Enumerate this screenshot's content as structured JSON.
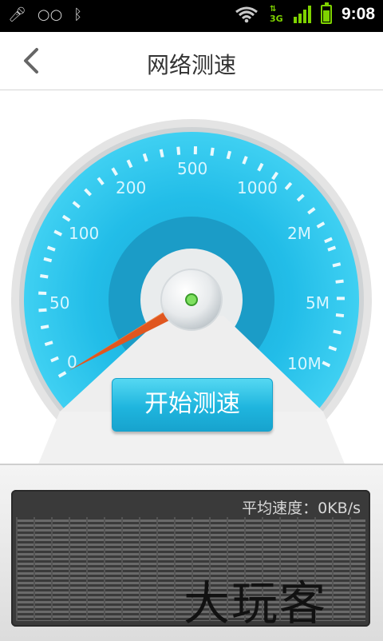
{
  "status_bar": {
    "time": "9:08",
    "network": "3G",
    "icons": [
      "mic-muted-icon",
      "voicemail-icon",
      "bluetooth-icon",
      "wifi-icon",
      "3g-signal-icon",
      "cell-signal-icon",
      "battery-icon"
    ]
  },
  "header": {
    "title": "网络测速",
    "back_icon": "back-arrow-icon"
  },
  "gauge": {
    "ticks": [
      "0",
      "50",
      "100",
      "200",
      "500",
      "1000",
      "2M",
      "5M",
      "10M"
    ],
    "needle_value": "0"
  },
  "action": {
    "start_label": "开始测速"
  },
  "result": {
    "average_speed_label": "平均速度：0KB/s"
  },
  "watermark": "大玩客",
  "colors": {
    "accent": "#1fb5de",
    "needle": "#e0561f",
    "dial": "#29c1ea"
  }
}
